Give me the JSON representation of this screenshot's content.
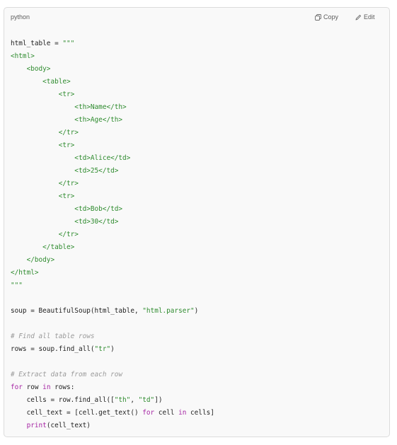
{
  "header": {
    "language": "python",
    "copy_label": "Copy",
    "edit_label": "Edit"
  },
  "code_lines": [
    [
      {
        "t": "html_table = ",
        "c": ""
      },
      {
        "t": "\"\"\"",
        "c": "str"
      }
    ],
    [
      {
        "t": "<html>",
        "c": "tag"
      }
    ],
    [
      {
        "t": "    <body>",
        "c": "tag"
      }
    ],
    [
      {
        "t": "        <table>",
        "c": "tag"
      }
    ],
    [
      {
        "t": "            <tr>",
        "c": "tag"
      }
    ],
    [
      {
        "t": "                <th>Name</th>",
        "c": "tag"
      }
    ],
    [
      {
        "t": "                <th>Age</th>",
        "c": "tag"
      }
    ],
    [
      {
        "t": "            </tr>",
        "c": "tag"
      }
    ],
    [
      {
        "t": "            <tr>",
        "c": "tag"
      }
    ],
    [
      {
        "t": "                <td>Alice</td>",
        "c": "tag"
      }
    ],
    [
      {
        "t": "                <td>25</td>",
        "c": "tag"
      }
    ],
    [
      {
        "t": "            </tr>",
        "c": "tag"
      }
    ],
    [
      {
        "t": "            <tr>",
        "c": "tag"
      }
    ],
    [
      {
        "t": "                <td>Bob</td>",
        "c": "tag"
      }
    ],
    [
      {
        "t": "                <td>30</td>",
        "c": "tag"
      }
    ],
    [
      {
        "t": "            </tr>",
        "c": "tag"
      }
    ],
    [
      {
        "t": "        </table>",
        "c": "tag"
      }
    ],
    [
      {
        "t": "    </body>",
        "c": "tag"
      }
    ],
    [
      {
        "t": "</html>",
        "c": "tag"
      }
    ],
    [
      {
        "t": "\"\"\"",
        "c": "str"
      }
    ],
    [],
    [
      {
        "t": "soup = BeautifulSoup(html_table, ",
        "c": ""
      },
      {
        "t": "\"html.parser\"",
        "c": "str"
      },
      {
        "t": ")",
        "c": ""
      }
    ],
    [],
    [
      {
        "t": "# Find all table rows",
        "c": "cm"
      }
    ],
    [
      {
        "t": "rows = soup.find_all(",
        "c": ""
      },
      {
        "t": "\"tr\"",
        "c": "str"
      },
      {
        "t": ")",
        "c": ""
      }
    ],
    [],
    [
      {
        "t": "# Extract data from each row",
        "c": "cm"
      }
    ],
    [
      {
        "t": "for",
        "c": "kw"
      },
      {
        "t": " row ",
        "c": ""
      },
      {
        "t": "in",
        "c": "kw"
      },
      {
        "t": " rows:",
        "c": ""
      }
    ],
    [
      {
        "t": "    cells = row.find_all([",
        "c": ""
      },
      {
        "t": "\"th\"",
        "c": "str"
      },
      {
        "t": ", ",
        "c": ""
      },
      {
        "t": "\"td\"",
        "c": "str"
      },
      {
        "t": "])",
        "c": ""
      }
    ],
    [
      {
        "t": "    cell_text = [cell.get_text() ",
        "c": ""
      },
      {
        "t": "for",
        "c": "kw"
      },
      {
        "t": " cell ",
        "c": ""
      },
      {
        "t": "in",
        "c": "kw"
      },
      {
        "t": " cells]",
        "c": ""
      }
    ],
    [
      {
        "t": "    ",
        "c": ""
      },
      {
        "t": "print",
        "c": "kw"
      },
      {
        "t": "(cell_text)",
        "c": ""
      }
    ]
  ],
  "icons": {
    "copy": "copy-icon",
    "edit": "edit-icon"
  },
  "colors": {
    "tag": "#2e8b2e",
    "string": "#2e8b2e",
    "keyword": "#a626a4",
    "comment": "#9a9a9a",
    "text": "#1f1f1f",
    "background": "#f9f9f9"
  }
}
